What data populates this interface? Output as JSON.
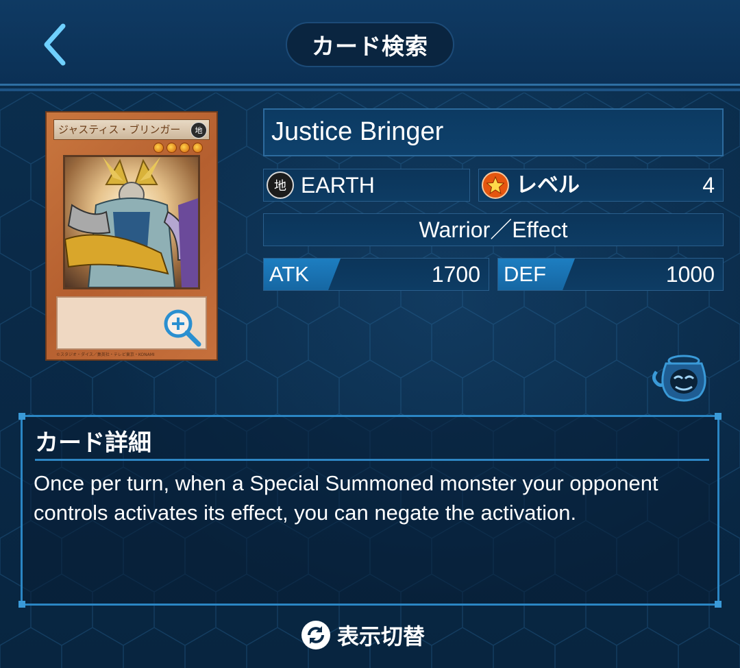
{
  "header": {
    "title": "カード検索",
    "back_icon": "chevron-left-icon"
  },
  "card": {
    "image_name": "ジャスティス・ブリンガー",
    "image_attribute": "地",
    "image_copyright": "©スタジオ・ダイス／集英社・テレビ東京・KONAMI",
    "name": "Justice Bringer",
    "attribute_icon_text": "地",
    "attribute": "EARTH",
    "level_label": "レベル",
    "level": "4",
    "type": "Warrior／Effect",
    "atk_label": "ATK",
    "atk": "1700",
    "def_label": "DEF",
    "def": "1000"
  },
  "details": {
    "title": "カード詳細",
    "text": "Once per turn, when a Special Summoned monster your opponent controls activates its effect, you can negate the activation."
  },
  "footer": {
    "toggle_label": "表示切替",
    "toggle_icon": "refresh-icon"
  },
  "colors": {
    "background": "#0a2a48",
    "panel_border": "#2a5f8d",
    "stat_tag": "#1d7ec1",
    "desc_border": "#2b86c4",
    "level_icon": "#e5560f"
  }
}
